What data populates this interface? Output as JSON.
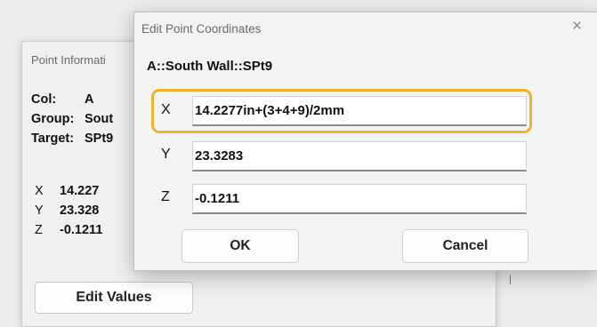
{
  "background_window": {
    "title": "Point Informati",
    "col_label": "Col:",
    "col_value": "A",
    "group_label": "Group:",
    "group_value": "Sout",
    "target_label": "Target:",
    "target_value": "SPt9",
    "coords": [
      {
        "axis": "X",
        "value": "14.227"
      },
      {
        "axis": "Y",
        "value": "23.328"
      },
      {
        "axis": "Z",
        "value": "-0.1211"
      }
    ],
    "edit_button": "Edit Values"
  },
  "dialog": {
    "title": "Edit Point Coordinates",
    "close_glyph": "×",
    "point_path": "A::South Wall::SPt9",
    "fields": [
      {
        "axis": "X",
        "value": "14.2277in+(3+4+9)/2mm"
      },
      {
        "axis": "Y",
        "value": "23.3283"
      },
      {
        "axis": "Z",
        "value": "-0.1211"
      }
    ],
    "ok_label": "OK",
    "cancel_label": "Cancel"
  },
  "colors": {
    "highlight": "#f2b12c"
  }
}
